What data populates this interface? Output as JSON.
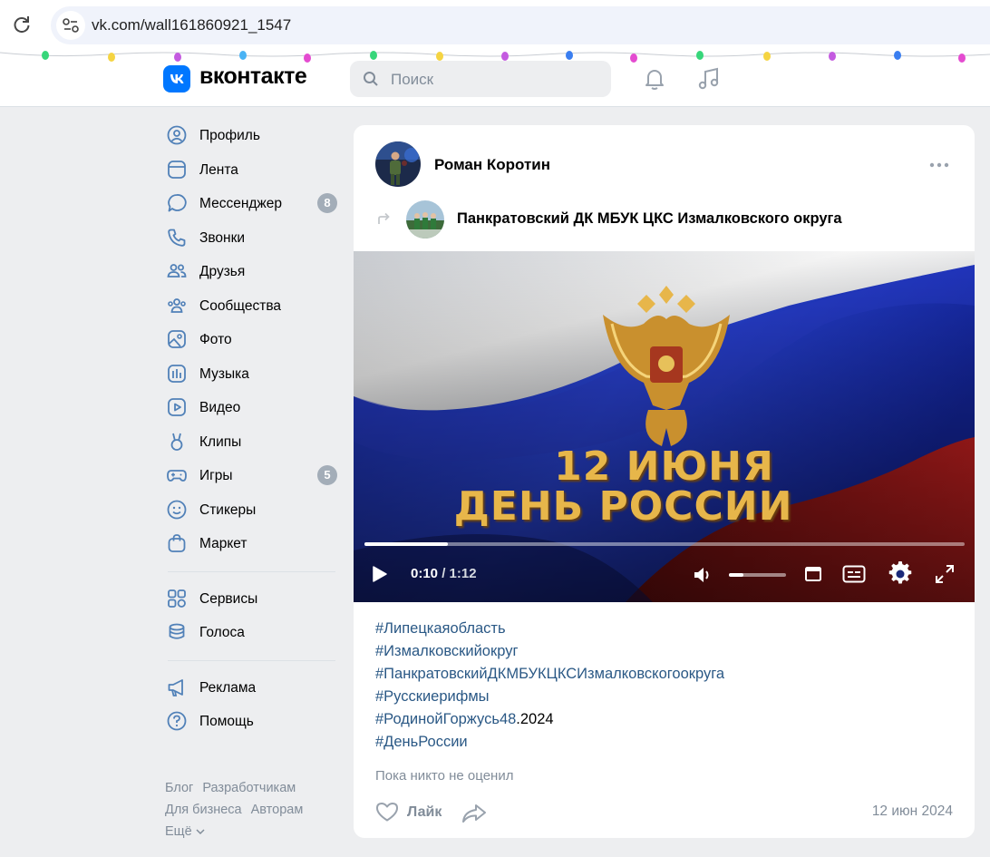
{
  "browser": {
    "url": "vk.com/wall161860921_1547",
    "icons": [
      "reload-icon",
      "site-info-icon"
    ]
  },
  "header": {
    "logo_text": "вконтакте",
    "search_placeholder": "Поиск",
    "icons": [
      "vk-logo-icon",
      "search-icon",
      "bell-icon",
      "music-icon"
    ]
  },
  "sidebar": {
    "items": [
      {
        "label": "Профиль",
        "icon": "profile-icon"
      },
      {
        "label": "Лента",
        "icon": "feed-icon"
      },
      {
        "label": "Мессенджер",
        "icon": "messenger-icon",
        "badge": "8"
      },
      {
        "label": "Звонки",
        "icon": "phone-icon"
      },
      {
        "label": "Друзья",
        "icon": "friends-icon"
      },
      {
        "label": "Сообщества",
        "icon": "communities-icon"
      },
      {
        "label": "Фото",
        "icon": "photo-icon"
      },
      {
        "label": "Музыка",
        "icon": "music-bars-icon"
      },
      {
        "label": "Видео",
        "icon": "video-icon"
      },
      {
        "label": "Клипы",
        "icon": "clips-icon"
      },
      {
        "label": "Игры",
        "icon": "games-icon",
        "badge": "5"
      },
      {
        "label": "Стикеры",
        "icon": "stickers-icon"
      },
      {
        "label": "Маркет",
        "icon": "market-icon"
      }
    ],
    "items2": [
      {
        "label": "Сервисы",
        "icon": "services-icon"
      },
      {
        "label": "Голоса",
        "icon": "votes-icon"
      }
    ],
    "items3": [
      {
        "label": "Реклама",
        "icon": "ads-icon"
      },
      {
        "label": "Помощь",
        "icon": "help-icon"
      }
    ],
    "footer": {
      "blog": "Блог",
      "developers": "Разработчикам",
      "business": "Для бизнеса",
      "authors": "Авторам",
      "more": "Ещё"
    }
  },
  "post": {
    "author": "Роман Коротин",
    "group": "Панкратовский ДК МБУК ЦКС Измалковского округа",
    "video": {
      "title_line1": "12 ИЮНЯ",
      "title_line2": "ДЕНЬ РОССИИ",
      "current_time": "0:10",
      "separator": " / ",
      "duration": "1:12",
      "progress_fraction": 0.139,
      "volume_fraction": 0.25
    },
    "hashtags": [
      {
        "link": "#Липецкаяобласть",
        "suffix": ""
      },
      {
        "link": "#Измалковскийокруг",
        "suffix": ""
      },
      {
        "link": "#ПанкратовскийДКМБУКЦКСИзмалковскогоокруга",
        "suffix": ""
      },
      {
        "link": "#Русскиерифмы",
        "suffix": ""
      },
      {
        "link": "#РодинойГоржусь48",
        "suffix": ".2024"
      },
      {
        "link": "#ДеньРоссии",
        "suffix": ""
      }
    ],
    "no_rating": "Пока никто не оценил",
    "like_label": "Лайк",
    "date": "12 июн 2024"
  },
  "colors": {
    "vk_blue": "#0077ff",
    "link": "#2a5885",
    "secondary_text": "#818c99",
    "badge": "#a3adb8",
    "page_bg": "#edeef0"
  }
}
